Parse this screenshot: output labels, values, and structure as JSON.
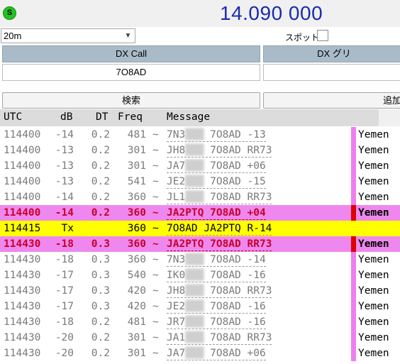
{
  "toolbar": {
    "status_badge": "S",
    "frequency": "14.090 000",
    "band": "20m",
    "spot_label": "スポット"
  },
  "dx": {
    "call_header": "DX Call",
    "grid_header": "DX グリ",
    "call_value": "7O8AD",
    "grid_value": "",
    "search_button": "検索",
    "add_button": "追加"
  },
  "list": {
    "columns": [
      "UTC",
      "dB",
      "DT",
      "Freq",
      "Message"
    ],
    "rows": [
      {
        "utc": "114400",
        "db": "-14",
        "dt": "0.2",
        "freq": "481",
        "sep": "~",
        "call": "7N3",
        "tail": " 7O8AD -13",
        "country": "Yemen",
        "style": "normal",
        "stripe": "violet"
      },
      {
        "utc": "114400",
        "db": "-13",
        "dt": "0.2",
        "freq": "301",
        "sep": "~",
        "call": "JH8",
        "tail": " 7O8AD RR73",
        "country": "Yemen",
        "style": "normal",
        "stripe": "violet"
      },
      {
        "utc": "114400",
        "db": "-13",
        "dt": "0.2",
        "freq": "301",
        "sep": "~",
        "call": "JA7",
        "tail": " 7O8AD +06",
        "country": "Yemen",
        "style": "normal",
        "stripe": "violet"
      },
      {
        "utc": "114400",
        "db": "-13",
        "dt": "0.2",
        "freq": "541",
        "sep": "~",
        "call": "JE2",
        "tail": " 7O8AD -15",
        "country": "Yemen",
        "style": "normal",
        "stripe": "violet"
      },
      {
        "utc": "114400",
        "db": "-14",
        "dt": "0.2",
        "freq": "360",
        "sep": "~",
        "call": "JL1",
        "tail": " 7O8AD RR73",
        "country": "Yemen",
        "style": "normal",
        "stripe": "violet"
      },
      {
        "utc": "114400",
        "db": "-14",
        "dt": "0.2",
        "freq": "360",
        "sep": "~",
        "call": "JA2PTQ",
        "tail": " 7O8AD +04",
        "country": "Yemen",
        "style": "hl-pink",
        "stripe": "red"
      },
      {
        "utc": "114415",
        "db": "Tx",
        "dt": "",
        "freq": "360",
        "sep": "~",
        "call": "7O8AD",
        "tail": " JA2PTQ R-14",
        "country": "",
        "style": "hl-yellow",
        "stripe": "none"
      },
      {
        "utc": "114430",
        "db": "-18",
        "dt": "0.3",
        "freq": "360",
        "sep": "~",
        "call": "JA2PTQ",
        "tail": " 7O8AD RR73",
        "country": "Yemen",
        "style": "hl-pink",
        "stripe": "red"
      },
      {
        "utc": "114430",
        "db": "-18",
        "dt": "0.3",
        "freq": "360",
        "sep": "~",
        "call": "7N3",
        "tail": " 7O8AD -14",
        "country": "Yemen",
        "style": "normal",
        "stripe": "violet"
      },
      {
        "utc": "114430",
        "db": "-17",
        "dt": "0.3",
        "freq": "540",
        "sep": "~",
        "call": "IK0",
        "tail": " 7O8AD -16",
        "country": "Yemen",
        "style": "normal",
        "stripe": "violet"
      },
      {
        "utc": "114430",
        "db": "-17",
        "dt": "0.3",
        "freq": "420",
        "sep": "~",
        "call": "JH8",
        "tail": " 7O8AD RR73",
        "country": "Yemen",
        "style": "normal",
        "stripe": "violet"
      },
      {
        "utc": "114430",
        "db": "-17",
        "dt": "0.3",
        "freq": "420",
        "sep": "~",
        "call": "JE2",
        "tail": " 7O8AD -16",
        "country": "Yemen",
        "style": "normal",
        "stripe": "violet"
      },
      {
        "utc": "114430",
        "db": "-18",
        "dt": "0.2",
        "freq": "481",
        "sep": "~",
        "call": "JR7",
        "tail": " 7O8AD -16",
        "country": "Yemen",
        "style": "normal",
        "stripe": "violet"
      },
      {
        "utc": "114430",
        "db": "-20",
        "dt": "0.2",
        "freq": "301",
        "sep": "~",
        "call": "JA1",
        "tail": " 7O8AD RR73",
        "country": "Yemen",
        "style": "normal",
        "stripe": "violet"
      },
      {
        "utc": "114430",
        "db": "-20",
        "dt": "0.2",
        "freq": "301",
        "sep": "~",
        "call": "JA7",
        "tail": " 7O8AD +06",
        "country": "Yemen",
        "style": "normal",
        "stripe": "violet"
      }
    ]
  }
}
